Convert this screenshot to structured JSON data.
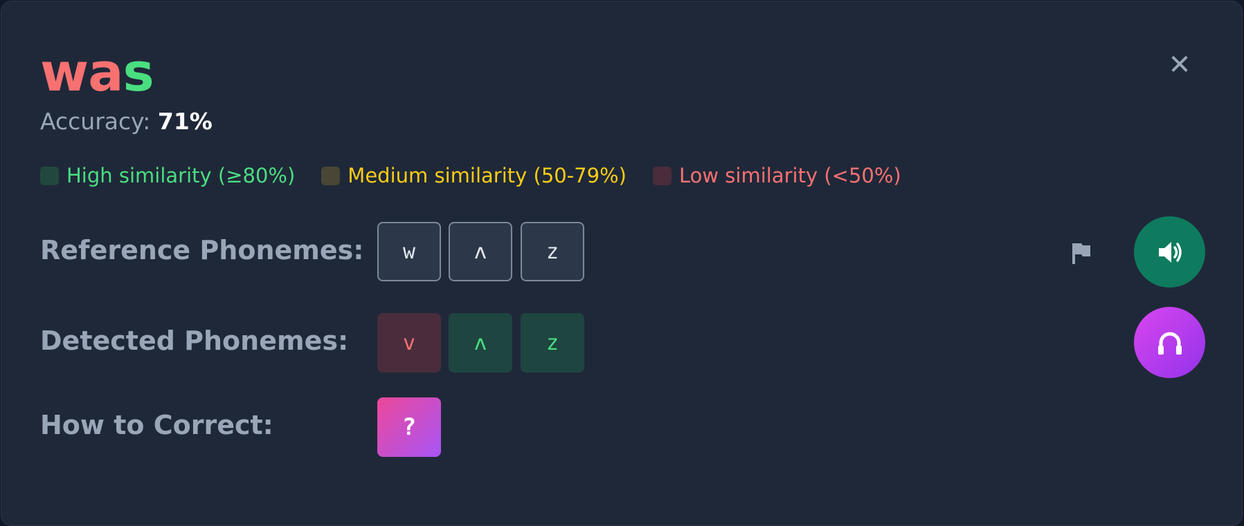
{
  "word": {
    "letters": [
      {
        "text": "w",
        "color": "#f87171"
      },
      {
        "text": "a",
        "color": "#f87171"
      },
      {
        "text": "s",
        "color": "#4ade80"
      }
    ]
  },
  "accuracy": {
    "label": "Accuracy: ",
    "value": "71%"
  },
  "legend": [
    {
      "label": "High similarity (≥80%)",
      "color": "#4ade80",
      "swatch": "#22473f"
    },
    {
      "label": "Medium similarity (50-79%)",
      "color": "#facc15",
      "swatch": "#4a4636"
    },
    {
      "label": "Low similarity (<50%)",
      "color": "#f87171",
      "swatch": "#4a2d3c"
    }
  ],
  "reference": {
    "label": "Reference Phonemes:",
    "phonemes": [
      "w",
      "ʌ",
      "z"
    ]
  },
  "detected": {
    "label": "Detected Phonemes:",
    "phonemes": [
      {
        "text": "v",
        "level": "low"
      },
      {
        "text": "ʌ",
        "level": "high"
      },
      {
        "text": "z",
        "level": "high"
      }
    ]
  },
  "correct": {
    "label": "How to Correct:",
    "help": "?"
  },
  "icons": {
    "close": "close-icon",
    "flag": "flag-icon",
    "speaker": "speaker-icon",
    "listen": "headphones-icon"
  },
  "close_glyph": "✕"
}
